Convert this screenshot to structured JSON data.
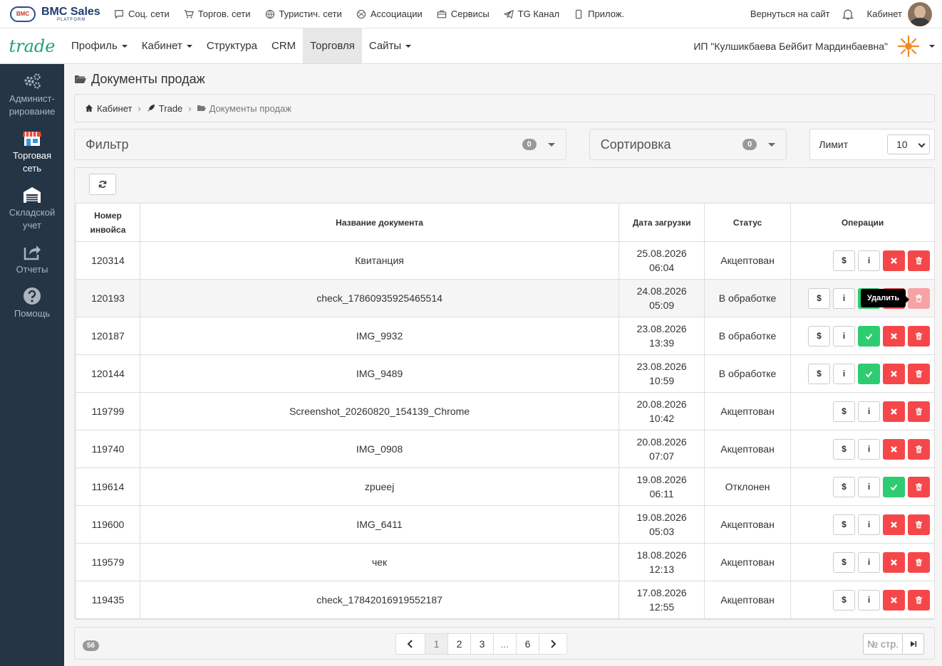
{
  "brand": {
    "name": "BMC Sales",
    "sub": "PLATFORM",
    "logo_text": "BMC"
  },
  "toplinks": [
    {
      "label": "Соц. сети",
      "icon": "chat-icon"
    },
    {
      "label": "Торгов. сети",
      "icon": "cart-icon"
    },
    {
      "label": "Туристич. сети",
      "icon": "globe-icon"
    },
    {
      "label": "Ассоциации",
      "icon": "network-icon"
    },
    {
      "label": "Сервисы",
      "icon": "briefcase-icon"
    },
    {
      "label": "TG Канал",
      "icon": "telegram-icon"
    },
    {
      "label": "Прилож.",
      "icon": "mobile-icon"
    }
  ],
  "topright": {
    "back": "Вернуться на сайт",
    "cabinet": "Кабинет"
  },
  "nav": {
    "brand": "trade",
    "items": [
      {
        "label": "Профиль",
        "caret": true
      },
      {
        "label": "Кабинет",
        "caret": true
      },
      {
        "label": "Структура",
        "caret": false
      },
      {
        "label": "CRM",
        "caret": false
      },
      {
        "label": "Торговля",
        "caret": false,
        "active": true
      },
      {
        "label": "Сайты",
        "caret": true
      }
    ],
    "org": "ИП \"Кулшикбаева Бейбит Мардинбаевна\""
  },
  "sidebar": [
    {
      "label1": "Админист-",
      "label2": "рирование",
      "icon": "gears-icon"
    },
    {
      "label1": "Торговая",
      "label2": "сеть",
      "icon": "store-icon",
      "active": true
    },
    {
      "label1": "Складской",
      "label2": "учет",
      "icon": "warehouse-icon"
    },
    {
      "label1": "Отчеты",
      "label2": "",
      "icon": "share-icon"
    },
    {
      "label1": "Помощь",
      "label2": "",
      "icon": "help-icon"
    }
  ],
  "page": {
    "title": "Документы продаж",
    "breadcrumb": [
      "Кабинет",
      "Trade",
      "Документы продаж"
    ]
  },
  "filter": {
    "label": "Фильтр",
    "count": "0"
  },
  "sort": {
    "label": "Сортировка",
    "count": "0"
  },
  "limit": {
    "label": "Лимит",
    "value": "10"
  },
  "table": {
    "headers": {
      "num1": "Номер",
      "num2": "инвойса",
      "name": "Название документа",
      "date": "Дата загрузки",
      "status": "Статус",
      "ops": "Операции"
    },
    "rows": [
      {
        "num": "120314",
        "name": "Квитанция",
        "date": "25.08.2026",
        "time": "06:04",
        "status": "Акцептован"
      },
      {
        "num": "120193",
        "name": "check_17860935925465514",
        "date": "24.08.2026",
        "time": "05:09",
        "status": "В обработке"
      },
      {
        "num": "120187",
        "name": "IMG_9932",
        "date": "23.08.2026",
        "time": "13:39",
        "status": "В обработке"
      },
      {
        "num": "120144",
        "name": "IMG_9489",
        "date": "23.08.2026",
        "time": "10:59",
        "status": "В обработке"
      },
      {
        "num": "119799",
        "name": "Screenshot_20260820_154139_Chrome",
        "date": "20.08.2026",
        "time": "10:42",
        "status": "Акцептован"
      },
      {
        "num": "119740",
        "name": "IMG_0908",
        "date": "20.08.2026",
        "time": "07:07",
        "status": "Акцептован"
      },
      {
        "num": "119614",
        "name": "zpueej",
        "date": "19.08.2026",
        "time": "06:11",
        "status": "Отклонен"
      },
      {
        "num": "119600",
        "name": "IMG_6411",
        "date": "19.08.2026",
        "time": "05:03",
        "status": "Акцептован"
      },
      {
        "num": "119579",
        "name": "чек",
        "date": "18.08.2026",
        "time": "12:13",
        "status": "Акцептован"
      },
      {
        "num": "119435",
        "name": "check_17842016919552187",
        "date": "17.08.2026",
        "time": "12:55",
        "status": "Акцептован"
      }
    ]
  },
  "ops": {
    "pay": "$",
    "info": "i",
    "tooltip_delete": "Удалить"
  },
  "pager": {
    "total": "56",
    "pages": [
      "1",
      "2",
      "3",
      "...",
      "6"
    ],
    "goto_placeholder": "№ стр."
  },
  "colors": {
    "accent_green": "#2ecc71",
    "danger": "#f5474a",
    "sidebar": "#253546",
    "brand_trade": "#1fa17a"
  }
}
